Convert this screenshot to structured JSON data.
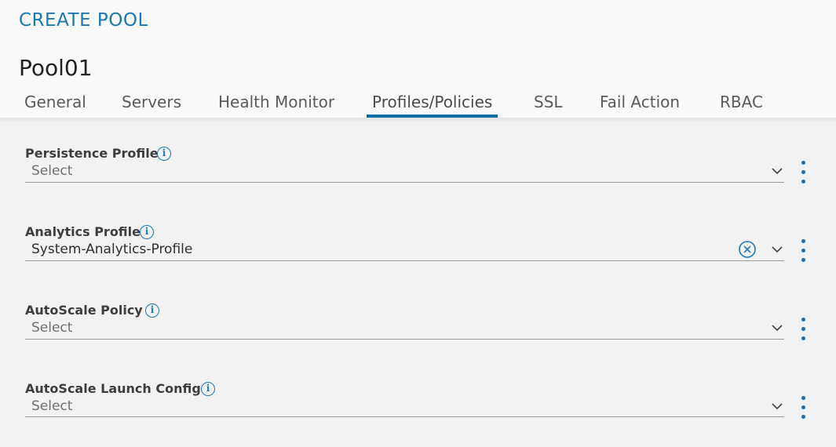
{
  "header": {
    "modal_title": "CREATE POOL",
    "pool_name": "Pool01"
  },
  "tabs": [
    {
      "label": "General"
    },
    {
      "label": "Servers"
    },
    {
      "label": "Health Monitor"
    },
    {
      "label": "Profiles/Policies",
      "active": true
    },
    {
      "label": "SSL"
    },
    {
      "label": "Fail Action"
    },
    {
      "label": "RBAC"
    }
  ],
  "fields": {
    "persistence_profile": {
      "label": "Persistence Profile",
      "value": "",
      "placeholder": "Select"
    },
    "analytics_profile": {
      "label": "Analytics Profile",
      "value": "System-Analytics-Profile",
      "placeholder": "Select"
    },
    "autoscale_policy": {
      "label": "AutoScale Policy",
      "value": "",
      "placeholder": "Select"
    },
    "autoscale_launch_config": {
      "label": "AutoScale Launch Config",
      "value": "",
      "placeholder": "Select"
    }
  },
  "icons": {
    "info": "info-icon",
    "dropdown": "chevron-down-icon",
    "clear": "clear-icon",
    "more": "kebab-menu-icon"
  },
  "colors": {
    "accent": "#1b78b4",
    "active_tab_underline": "#0f6fa5",
    "background": "#f2f2f2"
  }
}
